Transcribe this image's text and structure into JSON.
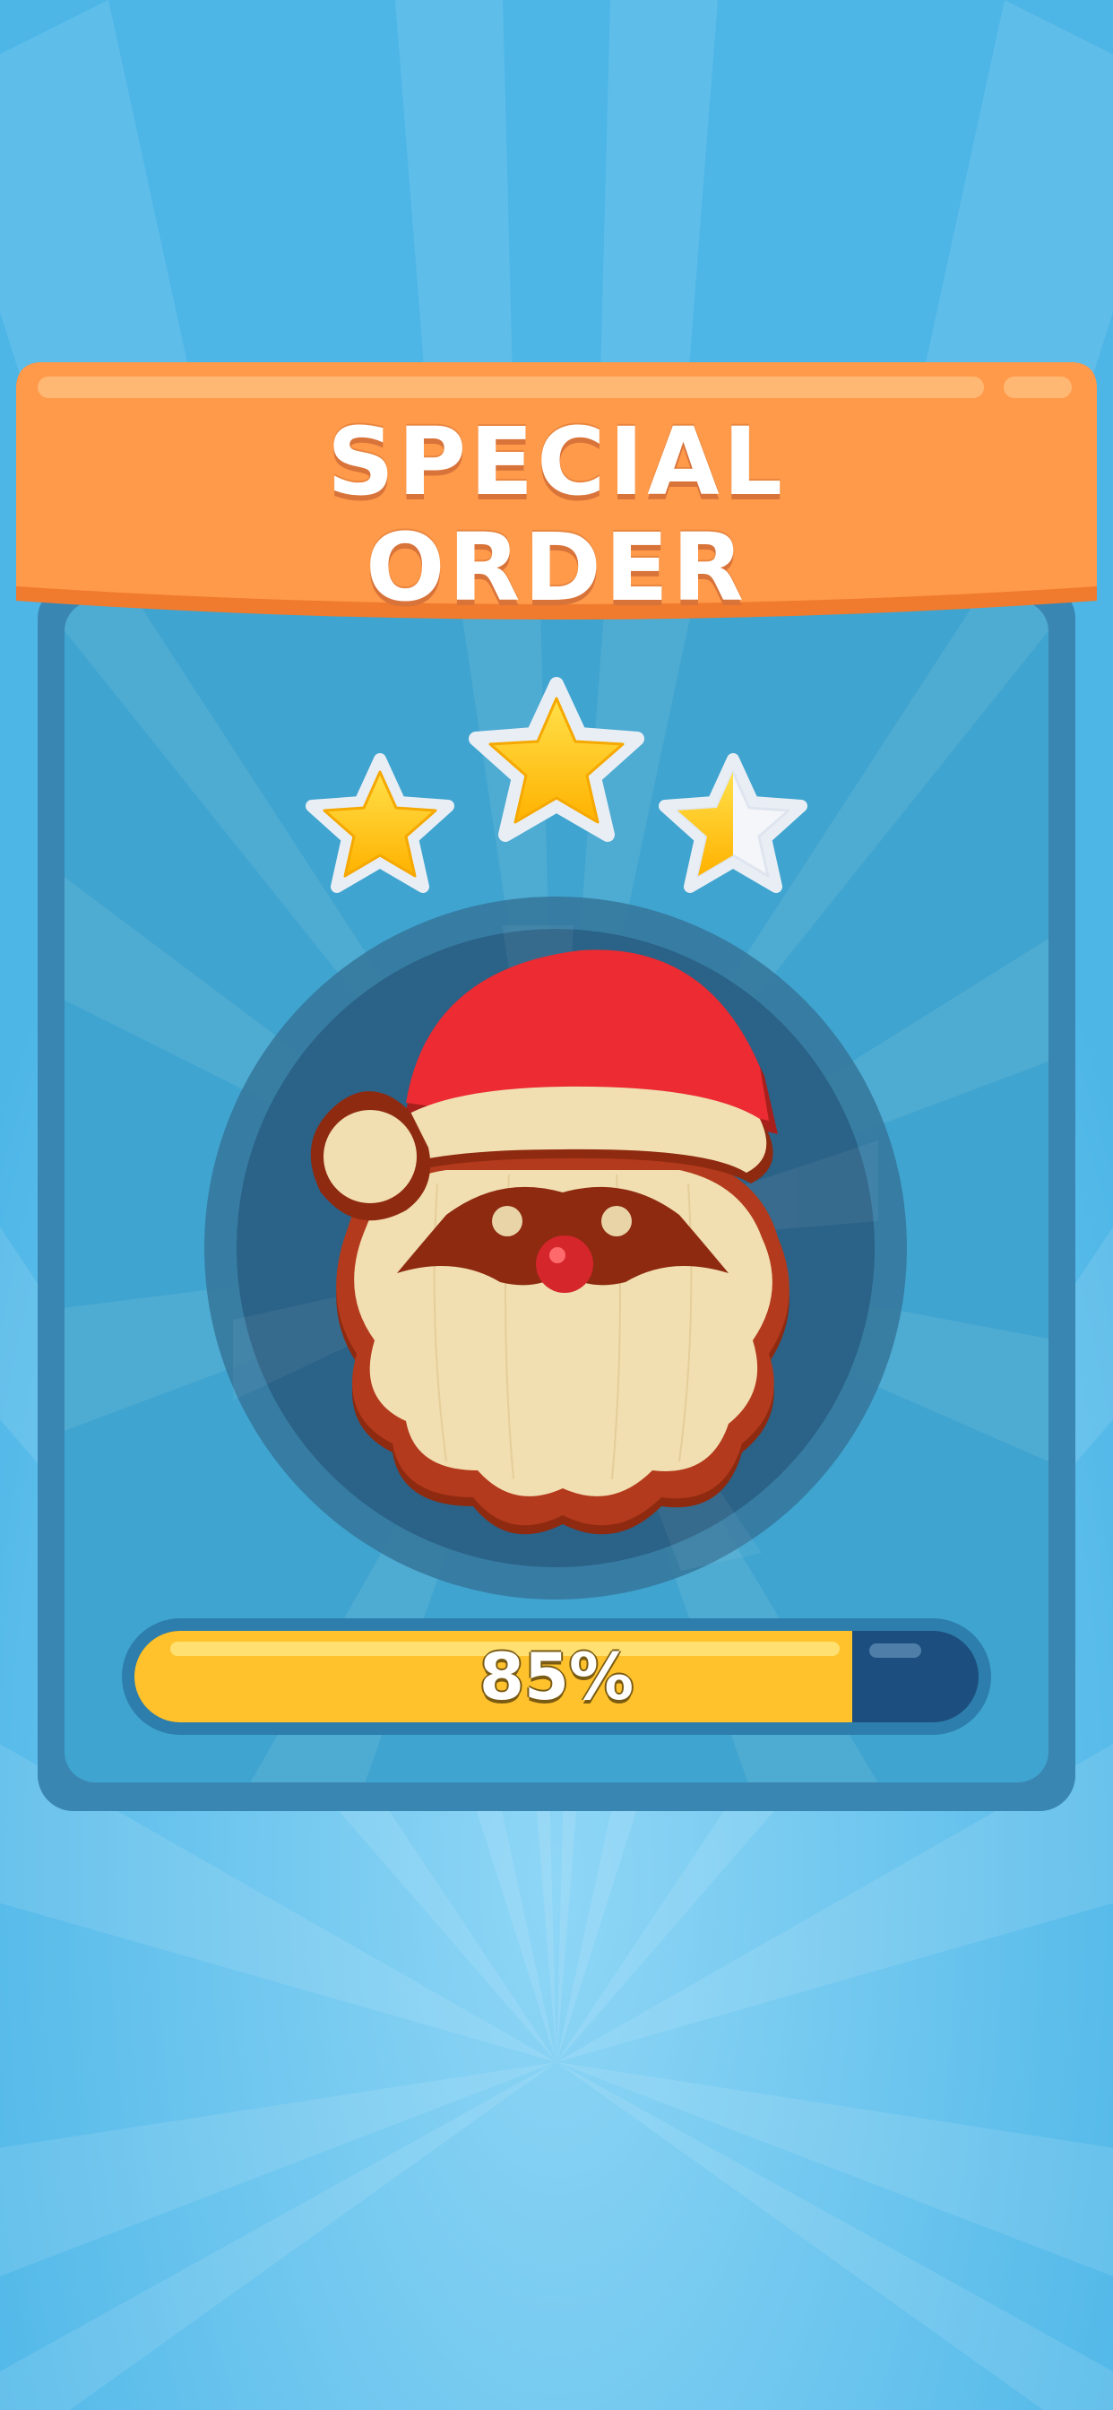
{
  "banner": {
    "title_line1": "SPECIAL",
    "title_line2": "ORDER"
  },
  "rating": {
    "stars_total": 3,
    "stars_filled": 2.5
  },
  "cookie": {
    "icon": "santa-cookie-icon"
  },
  "progress": {
    "label": "85%",
    "value": 0.85
  },
  "colors": {
    "background": "#4fb8e8",
    "banner": "#ff9a4a",
    "card": "#3fa4cf",
    "progress_fill": "#ffc22c",
    "progress_track": "#1c4f7f",
    "star": "#ffc61a"
  }
}
